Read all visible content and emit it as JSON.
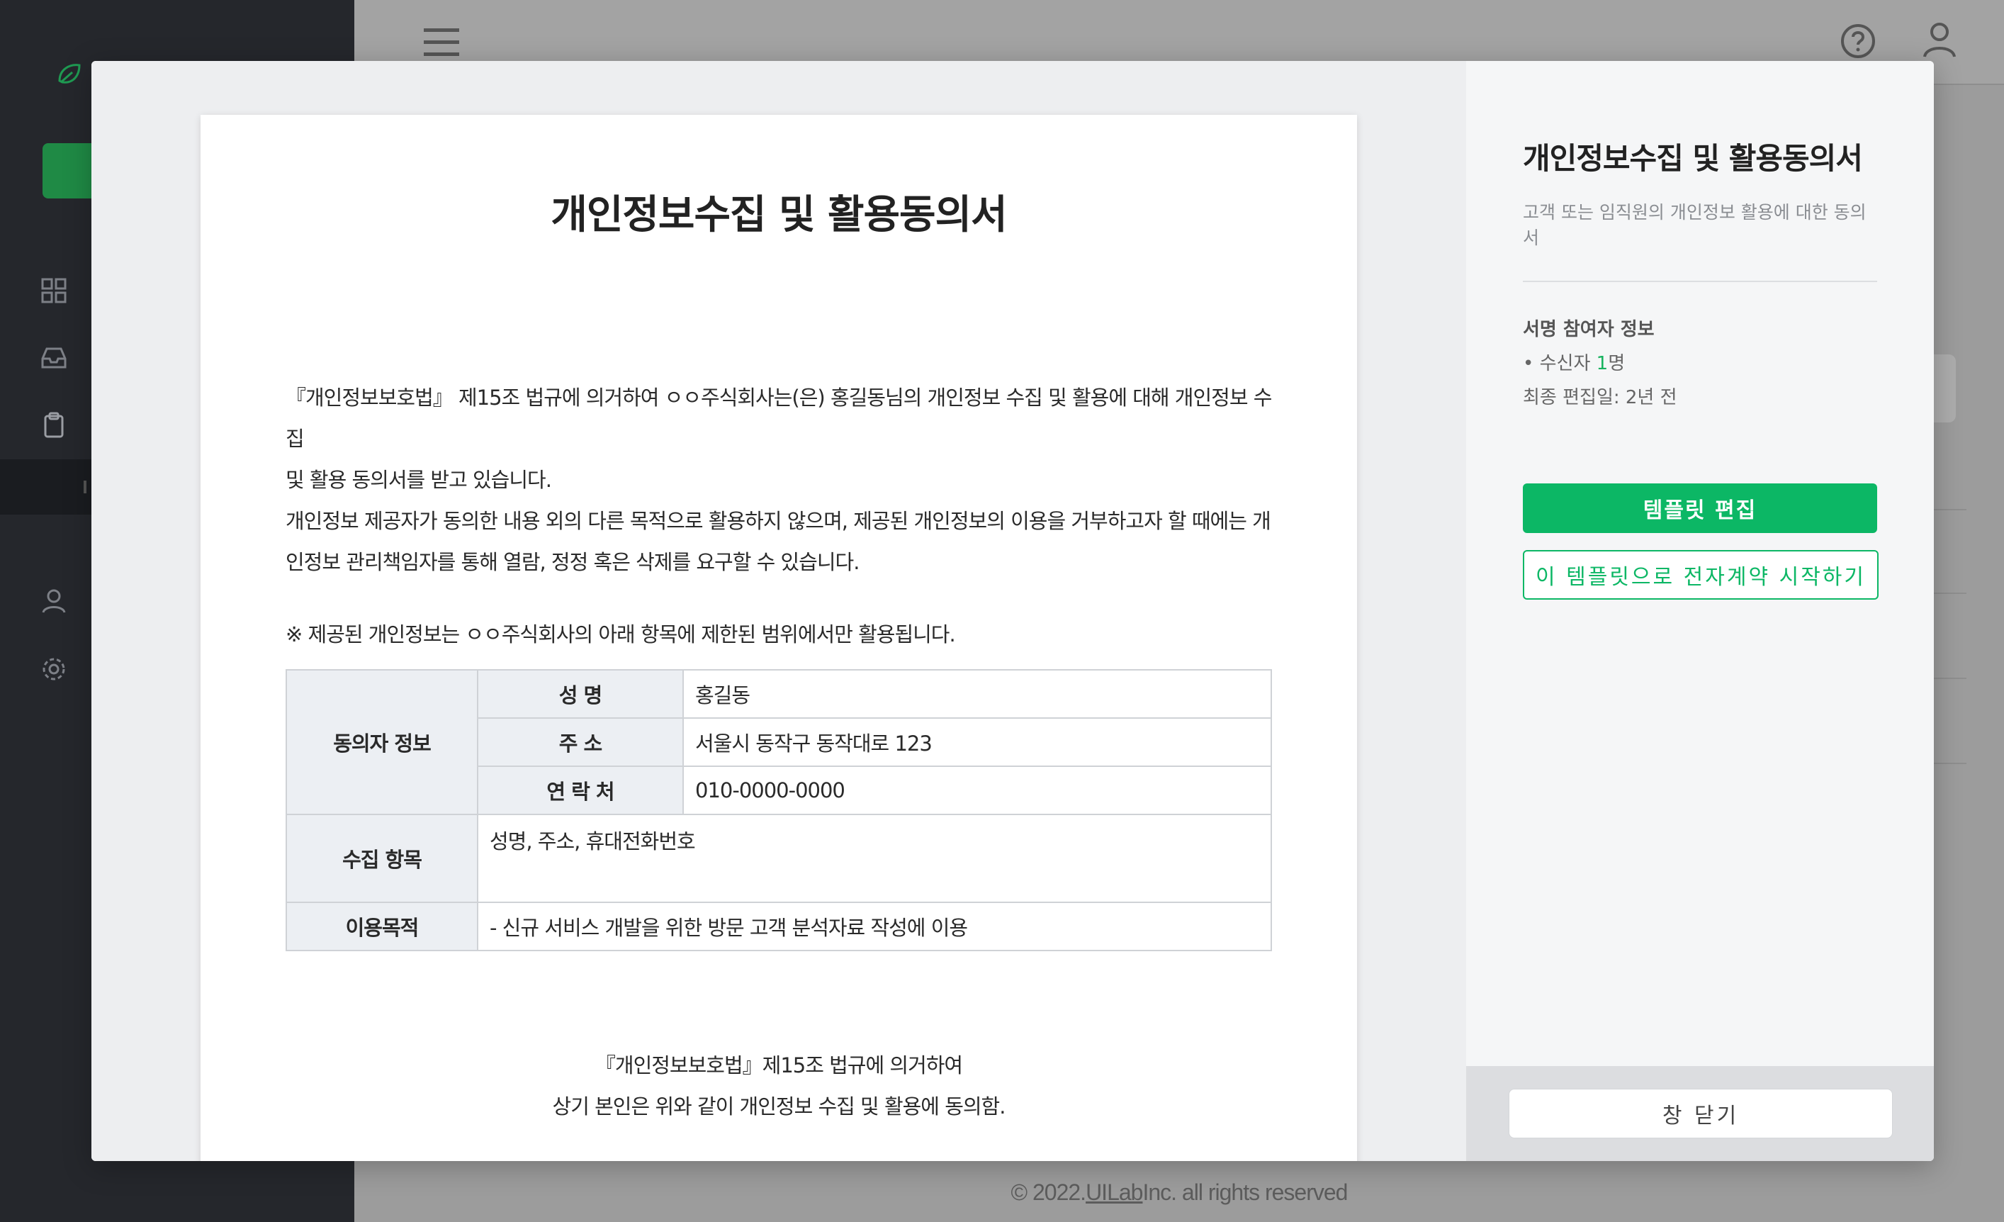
{
  "footer": {
    "prefix": "© 2022.",
    "company": "UILab",
    "suffix": "Inc. all rights reserved"
  },
  "document": {
    "title": "개인정보수집 및 활용동의서",
    "paragraph1_line1": "『개인정보보호법』 제15조 법규에 의거하여 ㅇㅇ주식회사는(은) 홍길동님의 개인정보 수집 및 활용에 대해 개인정보 수집",
    "paragraph1_line2": "및 활용 동의서를 받고 있습니다.",
    "paragraph2_line1": "개인정보 제공자가 동의한 내용 외의 다른 목적으로 활용하지 않으며, 제공된 개인정보의 이용을 거부하고자 할 때에는 개",
    "paragraph2_line2": "인정보 관리책임자를 통해 열람, 정정 혹은 삭제를 요구할 수 있습니다.",
    "note": "※ 제공된 개인정보는 ㅇㅇ주식회사의 아래 항목에 제한된 범위에서만 활용됩니다.",
    "table": {
      "consenter_header": "동의자 정보",
      "name_label": "성 명",
      "name_value": "홍길동",
      "address_label": "주 소",
      "address_value": "서울시 동작구 동작대로 123",
      "contact_label": "연 락 처",
      "contact_value": "010-0000-0000",
      "collect_label": "수집 항목",
      "collect_value": "성명, 주소, 휴대전화번호",
      "purpose_label": "이용목적",
      "purpose_value": "- 신규 서비스 개발을 위한 방문 고객 분석자료 작성에 이용"
    },
    "closing_line1": "『개인정보보호법』제15조 법규에 의거하여",
    "closing_line2": "상기 본인은 위와 같이 개인정보 수집 및 활용에 동의함."
  },
  "side": {
    "title": "개인정보수집 및 활용동의서",
    "description": "고객 또는 임직원의 개인정보 활용에 대한 동의서",
    "signer_heading": "서명 참여자 정보",
    "signer_prefix": "• 수신자 ",
    "signer_count": "1",
    "signer_unit": "명",
    "edited": "최종 편집일: 2년 전",
    "edit_button": "템플릿 편집",
    "start_button": "이 템플릿으로 전자계약 시작하기",
    "close_button": "창 닫기"
  },
  "colors": {
    "accent": "#0cb765",
    "sidebar": "#25272c"
  },
  "icons": [
    "leaf-logo-icon",
    "dashboard-icon",
    "inbox-icon",
    "clipboard-icon",
    "user-icon",
    "gear-icon",
    "menu-icon",
    "help-icon",
    "profile-icon"
  ]
}
